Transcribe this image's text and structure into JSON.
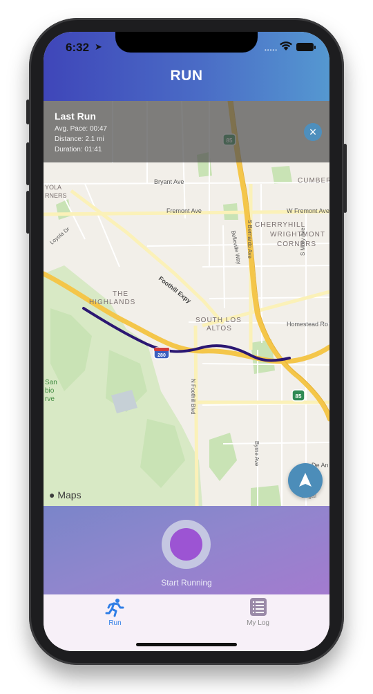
{
  "status_bar": {
    "time": "6:32",
    "signal": "•••••"
  },
  "header": {
    "title": "RUN"
  },
  "last_run": {
    "title": "Last Run",
    "avg_pace": "Avg. Pace: 00:47",
    "distance": "Distance:  2.1 mi",
    "duration": "Duration:  01:41"
  },
  "map": {
    "labels": {
      "bryant": "Bryant Ave",
      "cumber": "CUMBER",
      "cherry": "CHERRYHILL",
      "fremont": "Fremont Ave",
      "wfremont": "W Fremont Ave",
      "loyola": "Loyola Dr",
      "yola": "YOLA",
      "rners": "RNERS",
      "wrightmont1": "WRIGHTMONT",
      "wrightmont2": "CORNERS",
      "sbernardo": "S Bernardo Ave",
      "belleville": "Belleville Way",
      "smary": "S Mary Ave",
      "highlands1": "THE",
      "highlands2": "HIGHLANDS",
      "foothillexpy": "Foothill Expy",
      "southlos1": "SOUTH LOS",
      "southlos2": "ALTOS",
      "homestead": "Homestead Ro",
      "nfoothill": "N Foothill Blvd",
      "byrne": "Byrne Ave",
      "dean": "De An",
      "san1": "San",
      "san2": "bio",
      "san3": "rve",
      "shield85a": "85",
      "shield85b": "85",
      "shield280": "280"
    },
    "maps_logo": "Maps",
    "legal": "Legal"
  },
  "start": {
    "label": "Start Running"
  },
  "tabs": [
    {
      "label": "Run",
      "active": true,
      "icon": "runner-icon"
    },
    {
      "label": "My Log",
      "active": false,
      "icon": "list-icon"
    }
  ],
  "colors": {
    "accent": "#2f7ee6",
    "route": "#2b1772",
    "highway": "#f5cf4d",
    "start_button": "#9c54d3",
    "header_start": "#3f46b9",
    "header_end": "#5598d1"
  }
}
